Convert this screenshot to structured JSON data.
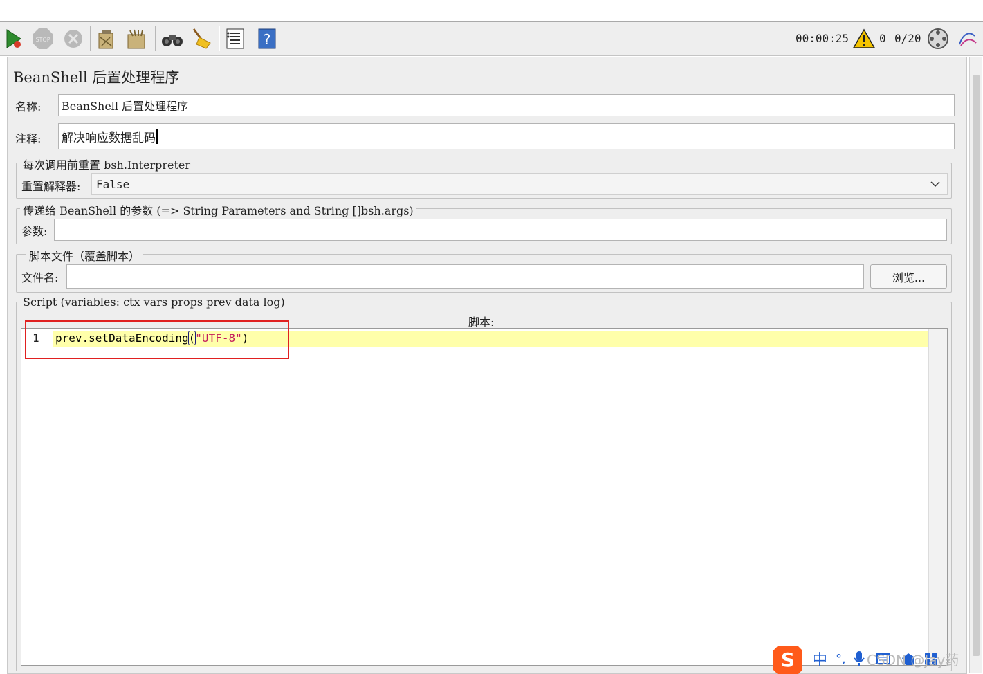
{
  "toolbar": {
    "timer": "00:00:25",
    "warning_count": "0",
    "threads": "0/20",
    "icons": [
      "start-icon",
      "stop-icon",
      "shutdown-icon",
      "clear-icon",
      "clear-all-icon",
      "search-icon",
      "reset-search-icon",
      "function-helper-icon",
      "help-icon",
      "warning-icon",
      "remote-icon",
      "logo-icon"
    ]
  },
  "panel": {
    "title": "BeanShell 后置处理程序",
    "name_label": "名称:",
    "name_value": "BeanShell 后置处理程序",
    "comment_label": "注释:",
    "comment_value": "解决响应数据乱码"
  },
  "reset_group": {
    "legend": "每次调用前重置 bsh.Interpreter",
    "label": "重置解释器:",
    "value": "False"
  },
  "params_group": {
    "legend": "传递给 BeanShell 的参数 (=> String Parameters and String []bsh.args)",
    "label": "参数:",
    "value": ""
  },
  "file_group": {
    "legend": "脚本文件（覆盖脚本）",
    "label": "文件名:",
    "value": "",
    "browse_label": "浏览..."
  },
  "script_group": {
    "legend": "Script (variables: ctx vars props prev data log)",
    "header": "脚本:",
    "line_number": "1",
    "code_method": "prev.setDataEncoding",
    "code_paren_open": "(",
    "code_string": "\"UTF-8\"",
    "code_paren_close": ")"
  },
  "ime": {
    "lang": "中",
    "punct": "°,",
    "watermark": "CSDN @Jay药"
  },
  "colors": {
    "current_line": "#ffffaa",
    "string_literal": "#c2185b",
    "highlight_box": "#e02020",
    "warning": "#f5c400"
  }
}
